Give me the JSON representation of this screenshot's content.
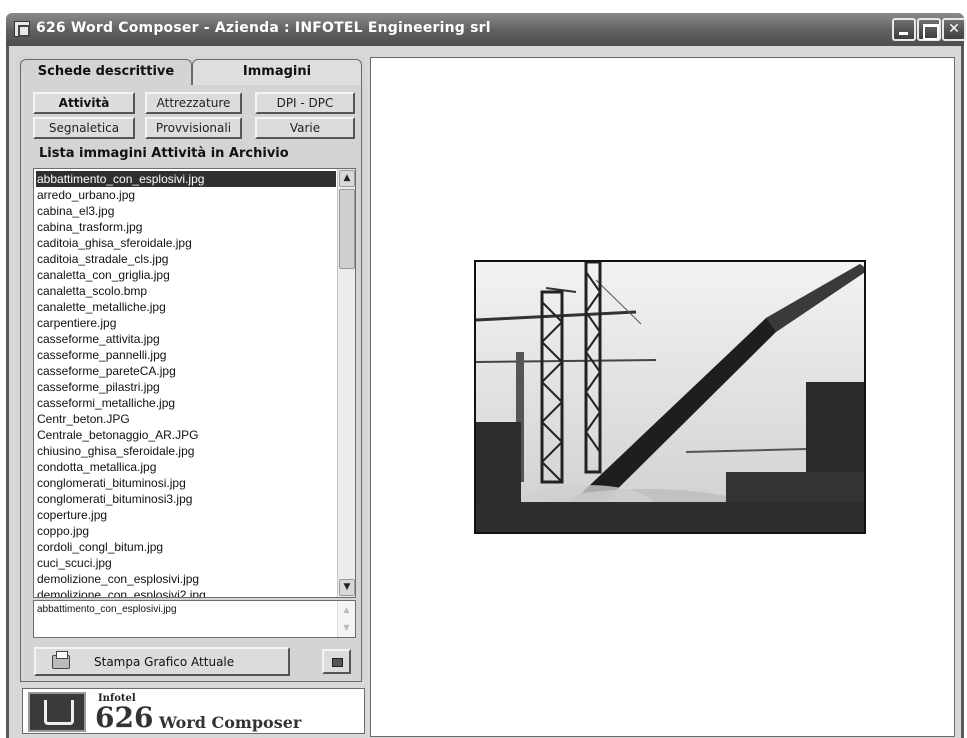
{
  "window": {
    "title": "626 Word Composer - Azienda : INFOTEL Engineering srl"
  },
  "tabs": {
    "schede": "Schede descrittive",
    "immagini": "Immagini"
  },
  "categories": {
    "attivita": "Attività",
    "attrezzature": "Attrezzature",
    "dpi_dpc": "DPI - DPC",
    "segnaletica": "Segnaletica",
    "provvisionali": "Provvisionali",
    "varie": "Varie"
  },
  "list": {
    "title": "Lista immagini Attività in Archivio",
    "items": [
      "abbattimento_con_esplosivi.jpg",
      "arredo_urbano.jpg",
      "cabina_el3.jpg",
      "cabina_trasform.jpg",
      "caditoia_ghisa_sferoidale.jpg",
      "caditoia_stradale_cls.jpg",
      "canaletta_con_griglia.jpg",
      "canaletta_scolo.bmp",
      "canalette_metalliche.jpg",
      "carpentiere.jpg",
      "casseforme_attivita.jpg",
      "casseforme_pannelli.jpg",
      "casseforme_pareteCA.jpg",
      "casseforme_pilastri.jpg",
      "casseformi_metalliche.jpg",
      "Centr_beton.JPG",
      "Centrale_betonaggio_AR.JPG",
      "chiusino_ghisa_sferoidale.jpg",
      "condotta_metallica.jpg",
      "conglomerati_bituminosi.jpg",
      "conglomerati_bituminosi3.jpg",
      "coperture.jpg",
      "coppo.jpg",
      "cordoli_congl_bitum.jpg",
      "cuci_scuci.jpg",
      "demolizione_con_esplosivi.jpg",
      "demolizione_con_esplosivi2.jpg"
    ],
    "selected_index": 0
  },
  "selected_filename": "abbattimento_con_esplosivi.jpg",
  "print_button": "Stampa Grafico Attuale",
  "logo": {
    "small": "Infotel",
    "number": "626",
    "name": "Word Composer"
  }
}
